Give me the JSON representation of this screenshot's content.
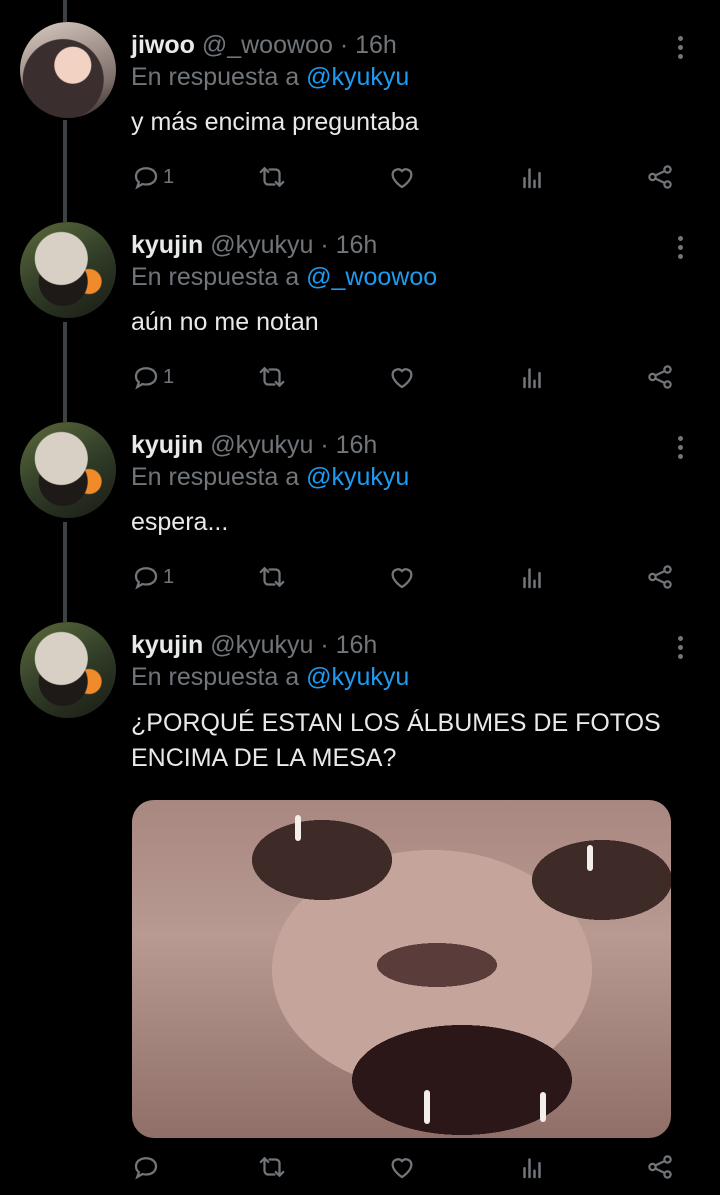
{
  "tweets": [
    {
      "name": "jiwoo",
      "handle": "@_woowoo",
      "time": "· 16h",
      "reply_prefix": "En respuesta a",
      "reply_to": "@kyukyu",
      "text": "y más encima preguntaba",
      "reply_count": "1",
      "avatar": "avatar-jiwoo"
    },
    {
      "name": "kyujin",
      "handle": "@kyukyu",
      "time": "· 16h",
      "reply_prefix": "En respuesta a",
      "reply_to": "@_woowoo",
      "text": "aún no me notan",
      "reply_count": "1",
      "avatar": "avatar-kyujin"
    },
    {
      "name": "kyujin",
      "handle": "@kyukyu",
      "time": "· 16h",
      "reply_prefix": "En respuesta a",
      "reply_to": "@kyukyu",
      "text": "espera...",
      "reply_count": "1",
      "avatar": "avatar-kyujin"
    },
    {
      "name": "kyujin",
      "handle": "@kyukyu",
      "time": "· 16h",
      "reply_prefix": "En respuesta a",
      "reply_to": "@kyukyu",
      "text_line1": "¿PORQUÉ ESTAN LOS ÁLBUMES DE FOTOS",
      "text_line2": "ENCIMA DE LA MESA?",
      "reply_count": "",
      "avatar": "avatar-kyujin",
      "media": "crying-cat-image"
    }
  ],
  "icons": [
    "reply-icon",
    "retweet-icon",
    "like-icon",
    "views-icon",
    "share-icon",
    "more-icon"
  ],
  "colors": {
    "background": "#000000",
    "text": "#e7e9ea",
    "muted": "#71767b",
    "accent": "#1d9bf0",
    "thread_line": "#3e4144"
  }
}
